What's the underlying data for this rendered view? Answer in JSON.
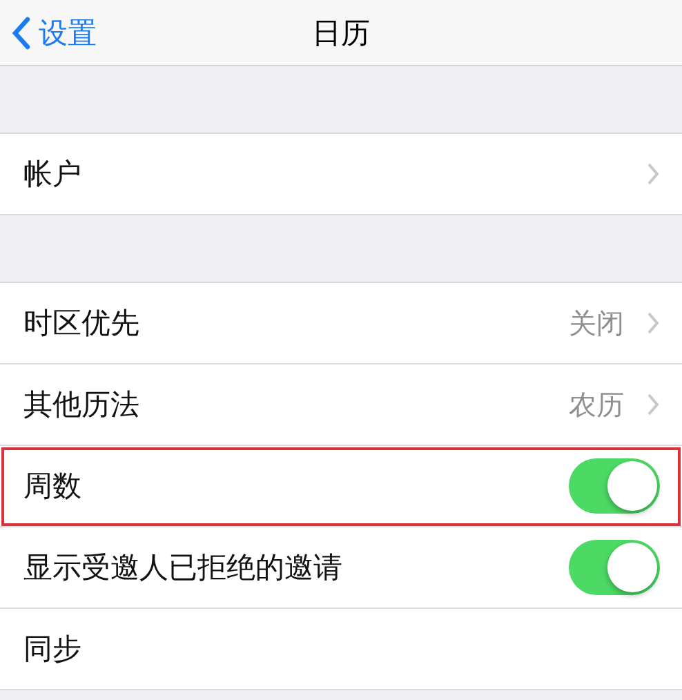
{
  "nav": {
    "back": "设置",
    "title": "日历"
  },
  "groups": [
    {
      "rows": [
        {
          "kind": "disclosure",
          "label": "帐户",
          "highlighted": false
        }
      ]
    },
    {
      "rows": [
        {
          "kind": "disclosure",
          "label": "时区优先",
          "value": "关闭",
          "highlighted": false
        },
        {
          "kind": "disclosure",
          "label": "其他历法",
          "value": "农历",
          "highlighted": false
        },
        {
          "kind": "toggle",
          "label": "周数",
          "on": true,
          "highlighted": true
        },
        {
          "kind": "toggle",
          "label": "显示受邀人已拒绝的邀请",
          "on": true,
          "highlighted": false
        },
        {
          "kind": "plain",
          "label": "同步",
          "highlighted": false
        }
      ]
    }
  ]
}
